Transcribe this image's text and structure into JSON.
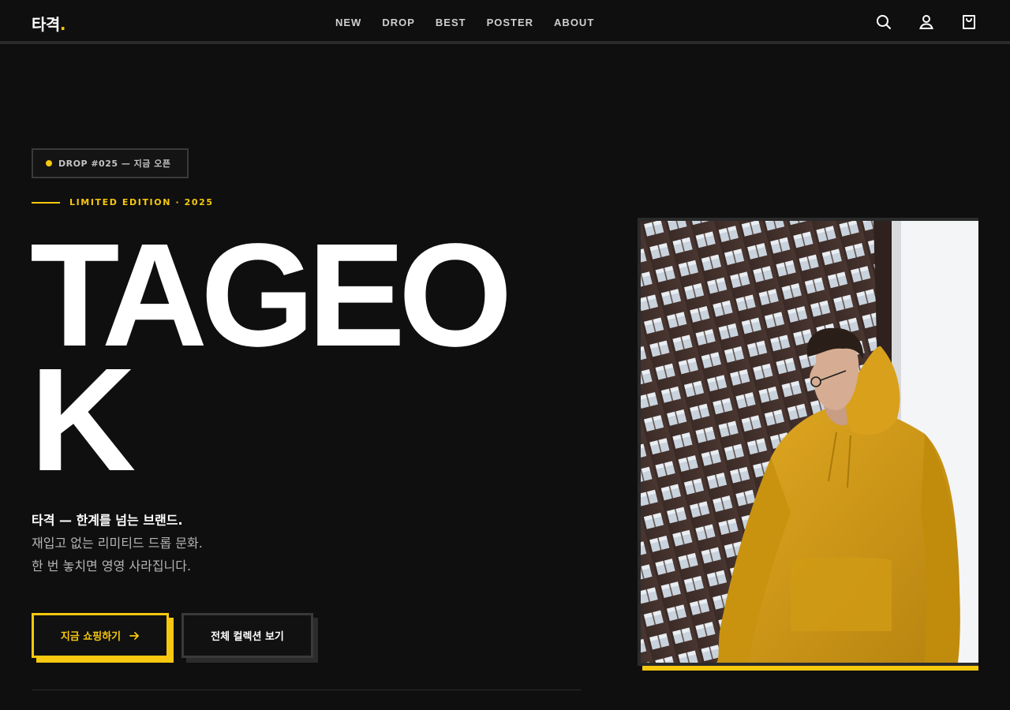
{
  "header": {
    "logo_text": "타격",
    "logo_dot": ".",
    "nav": [
      "NEW",
      "DROP",
      "BEST",
      "POSTER",
      "ABOUT"
    ],
    "icons": [
      "search-icon",
      "user-icon",
      "shopping-bag-icon"
    ]
  },
  "hero": {
    "badge": "DROP #025 — 지금 오픈",
    "edition": "LIMITED EDITION · 2025",
    "title": "TAGEOK",
    "tagline_line1": "타격 — 한계를 넘는 브랜드.",
    "tagline_line2": "재입고 없는 리미티드 드롭 문화.",
    "tagline_line3": "한 번 놓치면 영영 사라집니다.",
    "primary_button": "지금 쇼핑하기",
    "secondary_button": "전체 컬렉션 보기"
  },
  "colors": {
    "background": "#0f0f0f",
    "accent": "#f7c80f",
    "text": "#ffffff",
    "muted": "#b5b5b5"
  }
}
